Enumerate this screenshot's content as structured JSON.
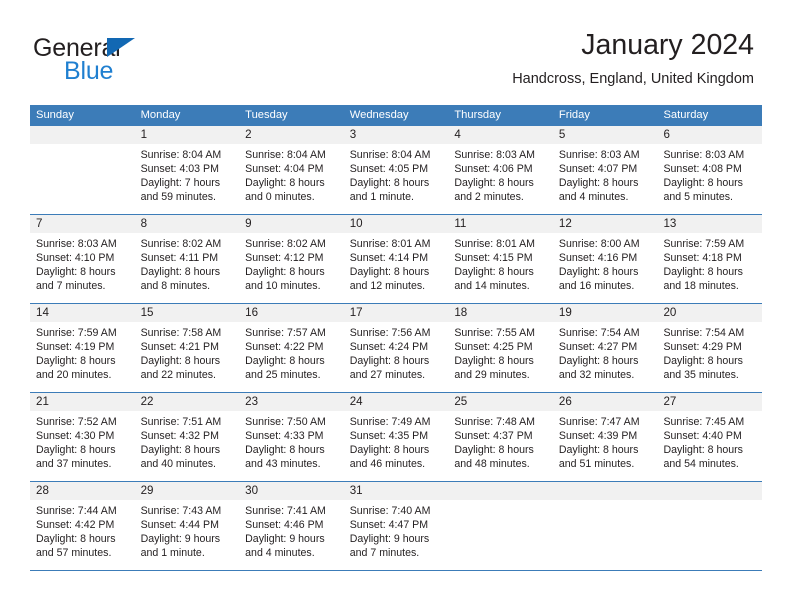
{
  "brand": {
    "name_part1": "General",
    "name_part2": "Blue",
    "triangle_color": "#1268b3",
    "blue_color": "#1f7fd0"
  },
  "header": {
    "title": "January 2024",
    "subtitle": "Handcross, England, United Kingdom"
  },
  "theme": {
    "header_bar_color": "#3c7cb8",
    "day_band_color": "#f1f1f1",
    "divider_color": "#3c7cb8",
    "text_color": "#231f20"
  },
  "calendar": {
    "weekday_headers": [
      "Sunday",
      "Monday",
      "Tuesday",
      "Wednesday",
      "Thursday",
      "Friday",
      "Saturday"
    ],
    "weeks": [
      [
        {
          "day": "",
          "lines": []
        },
        {
          "day": "1",
          "lines": [
            "Sunrise: 8:04 AM",
            "Sunset: 4:03 PM",
            "Daylight: 7 hours",
            "and 59 minutes."
          ]
        },
        {
          "day": "2",
          "lines": [
            "Sunrise: 8:04 AM",
            "Sunset: 4:04 PM",
            "Daylight: 8 hours",
            "and 0 minutes."
          ]
        },
        {
          "day": "3",
          "lines": [
            "Sunrise: 8:04 AM",
            "Sunset: 4:05 PM",
            "Daylight: 8 hours",
            "and 1 minute."
          ]
        },
        {
          "day": "4",
          "lines": [
            "Sunrise: 8:03 AM",
            "Sunset: 4:06 PM",
            "Daylight: 8 hours",
            "and 2 minutes."
          ]
        },
        {
          "day": "5",
          "lines": [
            "Sunrise: 8:03 AM",
            "Sunset: 4:07 PM",
            "Daylight: 8 hours",
            "and 4 minutes."
          ]
        },
        {
          "day": "6",
          "lines": [
            "Sunrise: 8:03 AM",
            "Sunset: 4:08 PM",
            "Daylight: 8 hours",
            "and 5 minutes."
          ]
        }
      ],
      [
        {
          "day": "7",
          "lines": [
            "Sunrise: 8:03 AM",
            "Sunset: 4:10 PM",
            "Daylight: 8 hours",
            "and 7 minutes."
          ]
        },
        {
          "day": "8",
          "lines": [
            "Sunrise: 8:02 AM",
            "Sunset: 4:11 PM",
            "Daylight: 8 hours",
            "and 8 minutes."
          ]
        },
        {
          "day": "9",
          "lines": [
            "Sunrise: 8:02 AM",
            "Sunset: 4:12 PM",
            "Daylight: 8 hours",
            "and 10 minutes."
          ]
        },
        {
          "day": "10",
          "lines": [
            "Sunrise: 8:01 AM",
            "Sunset: 4:14 PM",
            "Daylight: 8 hours",
            "and 12 minutes."
          ]
        },
        {
          "day": "11",
          "lines": [
            "Sunrise: 8:01 AM",
            "Sunset: 4:15 PM",
            "Daylight: 8 hours",
            "and 14 minutes."
          ]
        },
        {
          "day": "12",
          "lines": [
            "Sunrise: 8:00 AM",
            "Sunset: 4:16 PM",
            "Daylight: 8 hours",
            "and 16 minutes."
          ]
        },
        {
          "day": "13",
          "lines": [
            "Sunrise: 7:59 AM",
            "Sunset: 4:18 PM",
            "Daylight: 8 hours",
            "and 18 minutes."
          ]
        }
      ],
      [
        {
          "day": "14",
          "lines": [
            "Sunrise: 7:59 AM",
            "Sunset: 4:19 PM",
            "Daylight: 8 hours",
            "and 20 minutes."
          ]
        },
        {
          "day": "15",
          "lines": [
            "Sunrise: 7:58 AM",
            "Sunset: 4:21 PM",
            "Daylight: 8 hours",
            "and 22 minutes."
          ]
        },
        {
          "day": "16",
          "lines": [
            "Sunrise: 7:57 AM",
            "Sunset: 4:22 PM",
            "Daylight: 8 hours",
            "and 25 minutes."
          ]
        },
        {
          "day": "17",
          "lines": [
            "Sunrise: 7:56 AM",
            "Sunset: 4:24 PM",
            "Daylight: 8 hours",
            "and 27 minutes."
          ]
        },
        {
          "day": "18",
          "lines": [
            "Sunrise: 7:55 AM",
            "Sunset: 4:25 PM",
            "Daylight: 8 hours",
            "and 29 minutes."
          ]
        },
        {
          "day": "19",
          "lines": [
            "Sunrise: 7:54 AM",
            "Sunset: 4:27 PM",
            "Daylight: 8 hours",
            "and 32 minutes."
          ]
        },
        {
          "day": "20",
          "lines": [
            "Sunrise: 7:54 AM",
            "Sunset: 4:29 PM",
            "Daylight: 8 hours",
            "and 35 minutes."
          ]
        }
      ],
      [
        {
          "day": "21",
          "lines": [
            "Sunrise: 7:52 AM",
            "Sunset: 4:30 PM",
            "Daylight: 8 hours",
            "and 37 minutes."
          ]
        },
        {
          "day": "22",
          "lines": [
            "Sunrise: 7:51 AM",
            "Sunset: 4:32 PM",
            "Daylight: 8 hours",
            "and 40 minutes."
          ]
        },
        {
          "day": "23",
          "lines": [
            "Sunrise: 7:50 AM",
            "Sunset: 4:33 PM",
            "Daylight: 8 hours",
            "and 43 minutes."
          ]
        },
        {
          "day": "24",
          "lines": [
            "Sunrise: 7:49 AM",
            "Sunset: 4:35 PM",
            "Daylight: 8 hours",
            "and 46 minutes."
          ]
        },
        {
          "day": "25",
          "lines": [
            "Sunrise: 7:48 AM",
            "Sunset: 4:37 PM",
            "Daylight: 8 hours",
            "and 48 minutes."
          ]
        },
        {
          "day": "26",
          "lines": [
            "Sunrise: 7:47 AM",
            "Sunset: 4:39 PM",
            "Daylight: 8 hours",
            "and 51 minutes."
          ]
        },
        {
          "day": "27",
          "lines": [
            "Sunrise: 7:45 AM",
            "Sunset: 4:40 PM",
            "Daylight: 8 hours",
            "and 54 minutes."
          ]
        }
      ],
      [
        {
          "day": "28",
          "lines": [
            "Sunrise: 7:44 AM",
            "Sunset: 4:42 PM",
            "Daylight: 8 hours",
            "and 57 minutes."
          ]
        },
        {
          "day": "29",
          "lines": [
            "Sunrise: 7:43 AM",
            "Sunset: 4:44 PM",
            "Daylight: 9 hours",
            "and 1 minute."
          ]
        },
        {
          "day": "30",
          "lines": [
            "Sunrise: 7:41 AM",
            "Sunset: 4:46 PM",
            "Daylight: 9 hours",
            "and 4 minutes."
          ]
        },
        {
          "day": "31",
          "lines": [
            "Sunrise: 7:40 AM",
            "Sunset: 4:47 PM",
            "Daylight: 9 hours",
            "and 7 minutes."
          ]
        },
        {
          "day": "",
          "lines": []
        },
        {
          "day": "",
          "lines": []
        },
        {
          "day": "",
          "lines": []
        }
      ]
    ]
  }
}
